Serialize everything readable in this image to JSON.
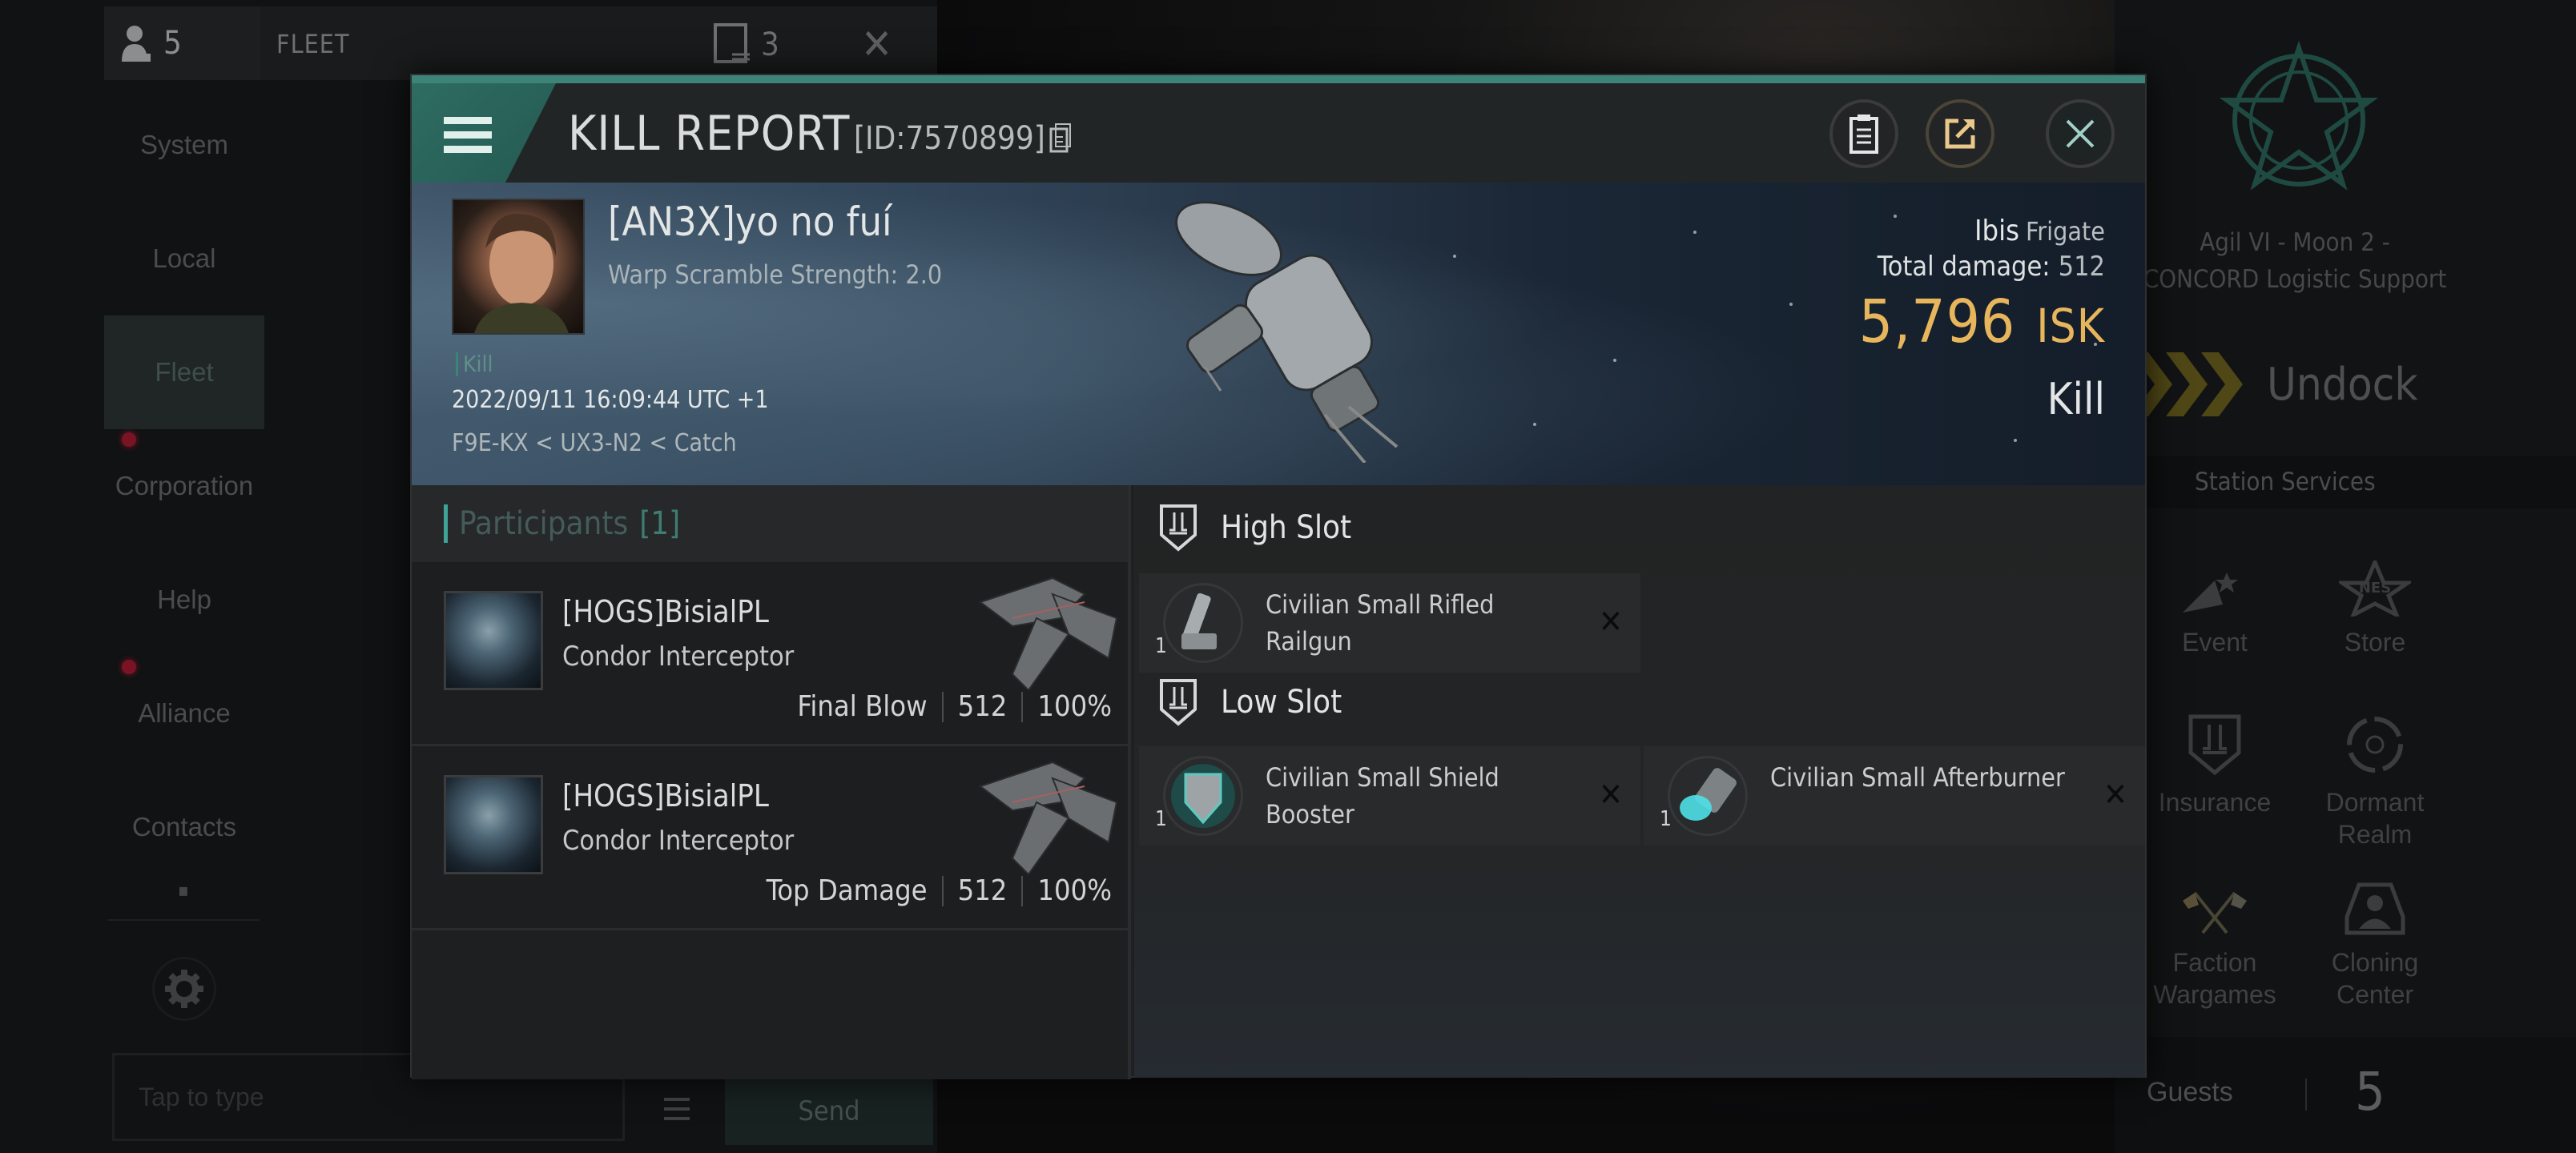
{
  "background": {
    "fleet_bar": {
      "member_count": "5",
      "title": "FLEET",
      "notes_count": "3"
    },
    "side_nav": [
      {
        "label": "System",
        "active": false,
        "badge": false
      },
      {
        "label": "Local",
        "active": false,
        "badge": false
      },
      {
        "label": "Fleet",
        "active": true,
        "badge": false
      },
      {
        "label": "Corporation",
        "active": false,
        "badge": true
      },
      {
        "label": "Help",
        "active": false,
        "badge": false
      },
      {
        "label": "Alliance",
        "active": false,
        "badge": true
      },
      {
        "label": "Contacts",
        "active": false,
        "badge": false
      }
    ],
    "chat": {
      "placeholder": "Tap to type",
      "send_label": "Send"
    },
    "station": {
      "name": "Agil VI - Moon 2 - CONCORD Logistic Support",
      "undock_label": "Undock",
      "services_title": "Station Services",
      "services": [
        {
          "label": "Event",
          "icon": "party-popper-icon"
        },
        {
          "label": "Store",
          "icon": "nes-star-icon"
        },
        {
          "label": "Insurance",
          "icon": "insurance-shield-icon"
        },
        {
          "label": "Dormant Realm",
          "icon": "dormant-realm-icon"
        },
        {
          "label": "Faction Wargames",
          "icon": "crossed-flags-icon"
        },
        {
          "label": "Cloning Center",
          "icon": "cloning-center-icon"
        }
      ],
      "guests_label": "Guests",
      "guests_count": "5"
    }
  },
  "kill_report": {
    "title": "KILL REPORT",
    "id_label": "[ID:7570899]",
    "header_buttons": [
      {
        "name": "clipboard",
        "icon": "clipboard-icon"
      },
      {
        "name": "share",
        "icon": "share-icon"
      },
      {
        "name": "close",
        "icon": "close-icon"
      }
    ],
    "victim": {
      "name": "[AN3X]yo no fuí",
      "subtitle": "Warp Scramble Strength: 2.0",
      "tag": "Kill",
      "timestamp": "2022/09/11 16:09:44 UTC +1",
      "location": "F9E-KX < UX3-N2 < Catch",
      "ship_name": "Ibis",
      "ship_class": "Frigate",
      "total_damage_label": "Total damage:",
      "total_damage": "512",
      "isk_value": "5,796",
      "isk_unit": "ISK",
      "result": "Kill"
    },
    "participants": {
      "title": "Participants",
      "count": "[1]",
      "rows": [
        {
          "name": "[HOGS]BisialPL",
          "ship": "Condor Interceptor",
          "role": "Final Blow",
          "damage": "512",
          "percent": "100%"
        },
        {
          "name": "[HOGS]BisialPL",
          "ship": "Condor Interceptor",
          "role": "Top Damage",
          "damage": "512",
          "percent": "100%"
        }
      ]
    },
    "fitting": {
      "high_slot_label": "High Slot",
      "low_slot_label": "Low Slot",
      "high_slot": [
        {
          "name": "Civilian Small Rifled Railgun",
          "qty": "1",
          "icon": "railgun-icon"
        }
      ],
      "low_slot": [
        {
          "name": "Civilian Small Shield Booster",
          "qty": "1",
          "icon": "shield-booster-icon"
        },
        {
          "name": "Civilian Small Afterburner",
          "qty": "1",
          "icon": "afterburner-icon"
        }
      ]
    },
    "colors": {
      "accent_teal": "#3d8478",
      "isk_gold": "#e7b65c"
    }
  }
}
